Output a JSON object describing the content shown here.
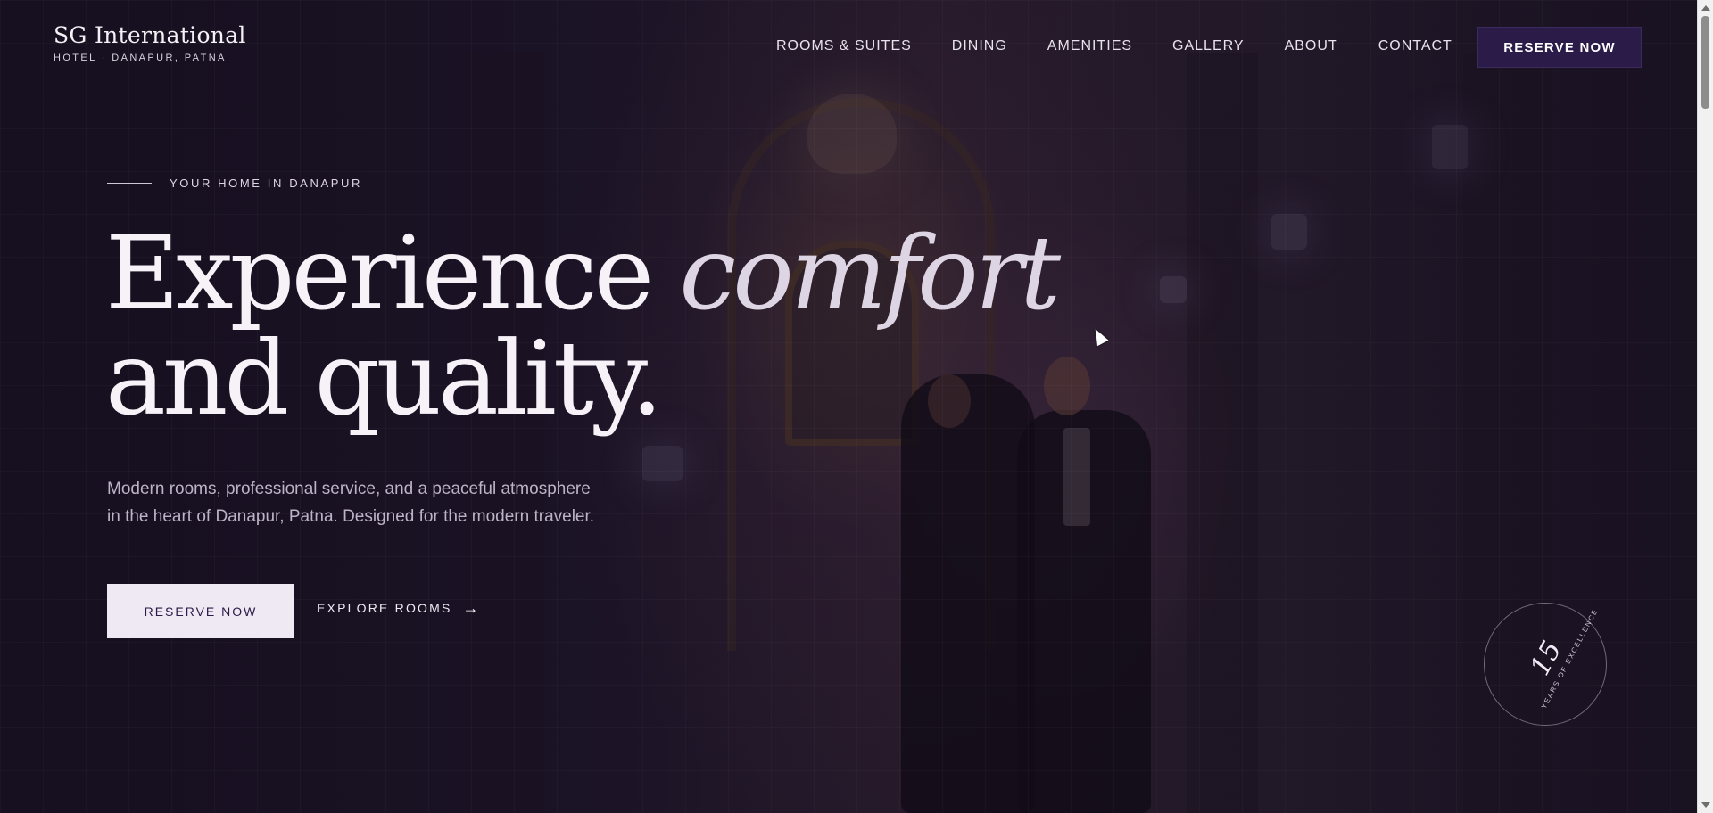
{
  "brand": {
    "name": "SG International",
    "subtitle": "HOTEL · DANAPUR, PATNA"
  },
  "nav": {
    "items": [
      "ROOMS & SUITES",
      "DINING",
      "AMENITIES",
      "GALLERY",
      "ABOUT",
      "CONTACT"
    ],
    "reserve_label": "RESERVE NOW"
  },
  "hero": {
    "eyebrow": "YOUR HOME IN DANAPUR",
    "headline_part1": "Experience",
    "headline_italic": "comfort",
    "headline_line2": "and quality.",
    "description_line1": "Modern rooms, professional service, and a peaceful atmosphere",
    "description_line2": "in the heart of Danapur, Patna. Designed for the modern traveler.",
    "cta_primary": "RESERVE NOW",
    "cta_secondary": "EXPLORE ROOMS",
    "cta_secondary_icon": "arrow-right-icon"
  },
  "badge": {
    "number": "15",
    "label": "YEARS OF EXCELLENCE"
  },
  "colors": {
    "brand_dark": "#2a1b48",
    "button_light": "#efe9f3",
    "background": "#1a1324"
  }
}
